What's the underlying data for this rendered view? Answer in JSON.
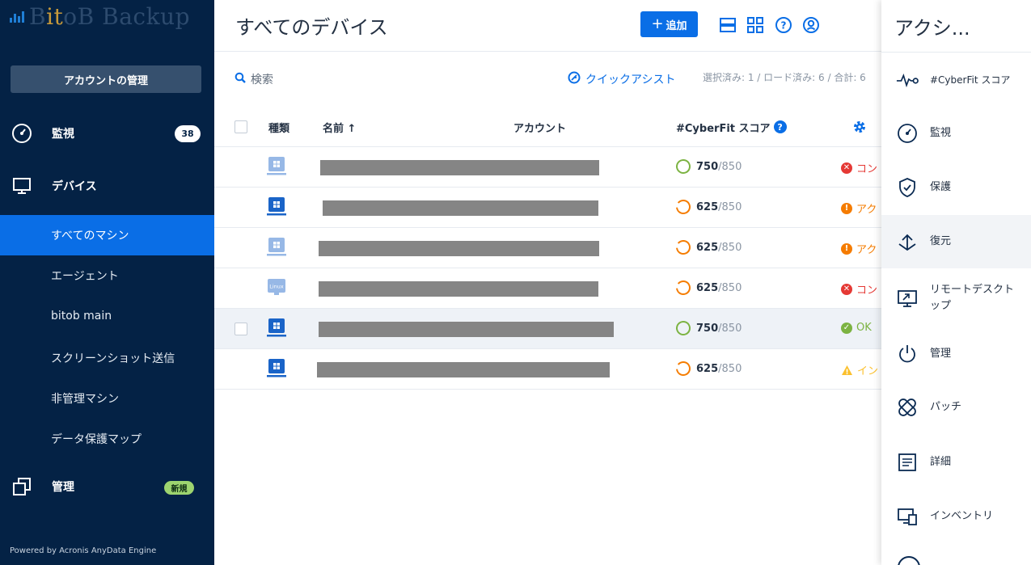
{
  "brand": {
    "name_prefix": "B",
    "name_it": "it",
    "name_suffix": "oB Backup"
  },
  "sidebar": {
    "account_button": "アカウントの管理",
    "monitoring": {
      "label": "監視",
      "badge": "38"
    },
    "devices": {
      "label": "デバイス"
    },
    "subitems": [
      "すべてのマシン",
      "エージェント",
      "bitob main",
      "スクリーンショット送信",
      "非管理マシン",
      "データ保護マップ"
    ],
    "management": {
      "label": "管理",
      "badge": "新規"
    },
    "powered_by": "Powered by Acronis AnyData Engine"
  },
  "header": {
    "title": "すべてのデバイス",
    "add_label": "追加"
  },
  "toolbar": {
    "search_label": "検索",
    "quick_assist": "クイックアシスト",
    "selection_info": "選択済み: 1 / ロード済み: 6 / 合計: 6"
  },
  "table": {
    "columns": {
      "type": "種類",
      "name": "名前 ↑",
      "account": "アカウント",
      "score": "#CyberFit スコア"
    },
    "score_max": "/850",
    "rows": [
      {
        "type": "windows",
        "score": "750",
        "status": "コン",
        "status_kind": "error"
      },
      {
        "type": "windows",
        "score": "625",
        "status": "アク",
        "status_kind": "warning"
      },
      {
        "type": "windows",
        "score": "625",
        "status": "アク",
        "status_kind": "warning"
      },
      {
        "type": "linux",
        "type_text": "Linux",
        "score": "625",
        "status": "コン",
        "status_kind": "error"
      },
      {
        "type": "windows",
        "score": "750",
        "status": "OK",
        "status_kind": "ok"
      },
      {
        "type": "windows",
        "score": "625",
        "status": "イン",
        "status_kind": "alert"
      }
    ]
  },
  "actions": {
    "title": "アクシ...",
    "items": [
      "#CyberFit スコア",
      "監視",
      "保護",
      "復元",
      "リモートデスクトップ",
      "管理",
      "パッチ",
      "詳細",
      "インベントリ"
    ]
  },
  "colors": {
    "sidebar": "#042245",
    "accent": "#0a6ee6",
    "score_good": "#7cb342",
    "score_mid": "#f57c00",
    "error": "#e53935",
    "warning": "#f57c00",
    "ok": "#7cb342",
    "alert": "#fbc02d"
  }
}
